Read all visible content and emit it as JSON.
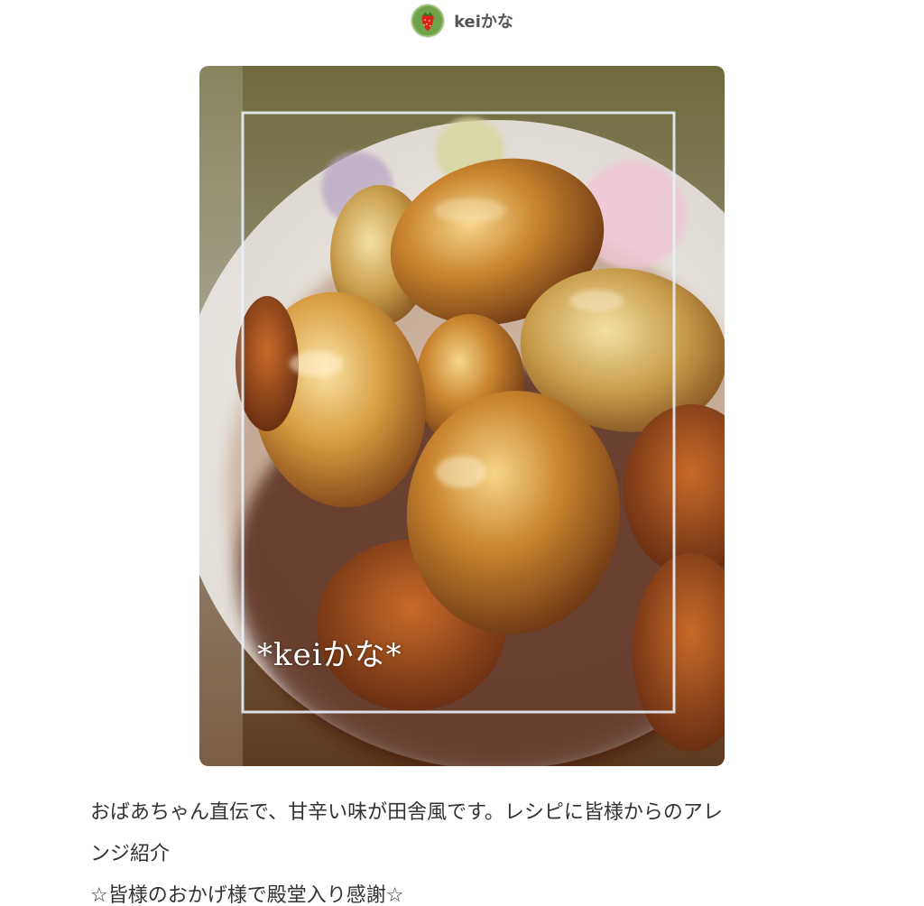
{
  "author": {
    "name": "keiかな",
    "avatar_icon": "strawberry-avatar-icon"
  },
  "photo": {
    "watermark": "*keiかな*"
  },
  "description": {
    "line1": "おばあちゃん直伝で、甘辛い味が田舎風です。レシピに皆様からのアレ",
    "line2": "ンジ紹介",
    "line3": "☆皆様のおかげ様で殿堂入り感謝☆"
  },
  "colors": {
    "text": "#333333",
    "author_text": "#555555",
    "background": "#ffffff"
  }
}
